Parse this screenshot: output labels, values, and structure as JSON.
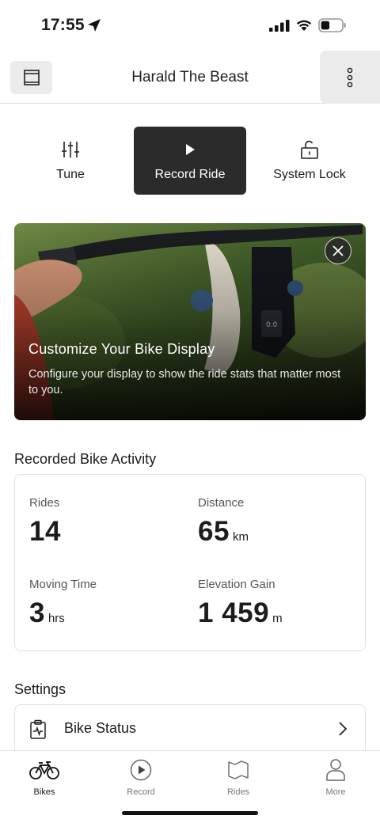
{
  "status_bar": {
    "time": "17:55",
    "battery_level": 0.35
  },
  "header": {
    "title": "Harald The Beast",
    "left_icon": "panel-icon",
    "menu_icon": "more-vertical-icon"
  },
  "actions": [
    {
      "label": "Tune",
      "icon": "sliders-icon",
      "active": false
    },
    {
      "label": "Record Ride",
      "icon": "play-icon",
      "active": true
    },
    {
      "label": "System Lock",
      "icon": "unlock-icon",
      "active": false
    }
  ],
  "promo": {
    "title": "Customize Your Bike Display",
    "text": "Configure your display to show the ride stats that matter most to you.",
    "close_icon": "close-icon"
  },
  "activity": {
    "title": "Recorded Bike Activity",
    "stats": [
      {
        "label": "Rides",
        "value": "14",
        "unit": ""
      },
      {
        "label": "Distance",
        "value": "65",
        "unit": "km"
      },
      {
        "label": "Moving Time",
        "value": "3",
        "unit": "hrs"
      },
      {
        "label": "Elevation Gain",
        "value": "1 459",
        "unit": "m"
      }
    ]
  },
  "settings": {
    "title": "Settings",
    "items": [
      {
        "label": "Bike Status",
        "icon": "clipboard-pulse-icon"
      }
    ]
  },
  "tabs": [
    {
      "label": "Bikes",
      "icon": "bike-icon",
      "active": true
    },
    {
      "label": "Record",
      "icon": "play-circle-icon",
      "active": false
    },
    {
      "label": "Rides",
      "icon": "map-icon",
      "active": false
    },
    {
      "label": "More",
      "icon": "person-icon",
      "active": false
    }
  ],
  "colors": {
    "active_action_bg": "#2b2b2b",
    "header_button_bg": "#ebebeb",
    "text": "#1c1c1e"
  }
}
